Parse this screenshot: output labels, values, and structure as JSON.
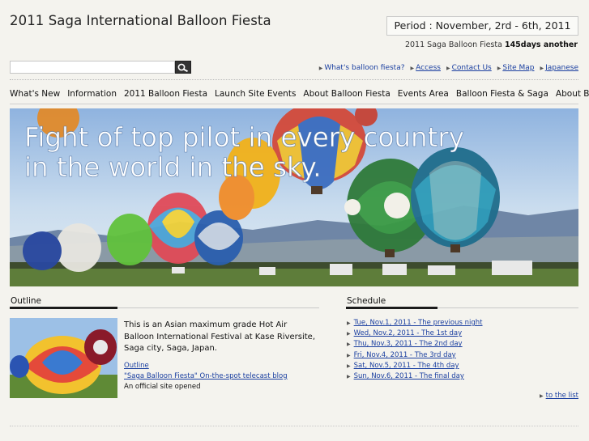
{
  "header": {
    "title": "2011 Saga International Balloon Fiesta",
    "period": "Period : November, 2rd - 6th, 2011",
    "countdown_prefix": "2011 Saga Balloon Fiesta ",
    "countdown_bold": "145days another"
  },
  "search": {
    "placeholder": "",
    "button_icon": "search-icon"
  },
  "util_links": [
    {
      "label": "What's balloon fiesta?",
      "linked": false
    },
    {
      "label": "Access",
      "linked": true
    },
    {
      "label": "Contact Us",
      "linked": true
    },
    {
      "label": "Site Map",
      "linked": true
    },
    {
      "label": "Japanese",
      "linked": true
    }
  ],
  "nav": [
    "What's New",
    "Information",
    "2011 Balloon Fiesta",
    "Launch Site Events",
    "About Balloon Fiesta",
    "Events Area",
    "Balloon Fiesta & Saga",
    "About Balloon"
  ],
  "hero": {
    "caption_line1": "Fight of top pilot in every country",
    "caption_line2": "in the world in the sky."
  },
  "outline": {
    "heading": "Outline",
    "text": "This is an Asian maximum grade Hot Air Balloon International Festival at Kase Riversite, Saga city, Saga, Japan.",
    "link1": "Outline",
    "link2": "\"Saga Balloon Fiesta\" On-the-spot telecast blog",
    "note": "An official site opened"
  },
  "schedule": {
    "heading": "Schedule",
    "items": [
      "Tue, Nov.1, 2011 - The previous night",
      "Wed, Nov.2, 2011 - The 1st day",
      "Thu, Nov.3, 2011 - The 2nd day",
      "Fri, Nov.4, 2011 - The 3rd day",
      "Sat, Nov.5, 2011 - The 4th day",
      "Sun, Nov.6, 2011 - The final day"
    ],
    "to_list": "to the list"
  },
  "colors": {
    "link": "#1a3fa0",
    "background": "#f4f3ee",
    "heading_bar": "#1b1b1b"
  }
}
